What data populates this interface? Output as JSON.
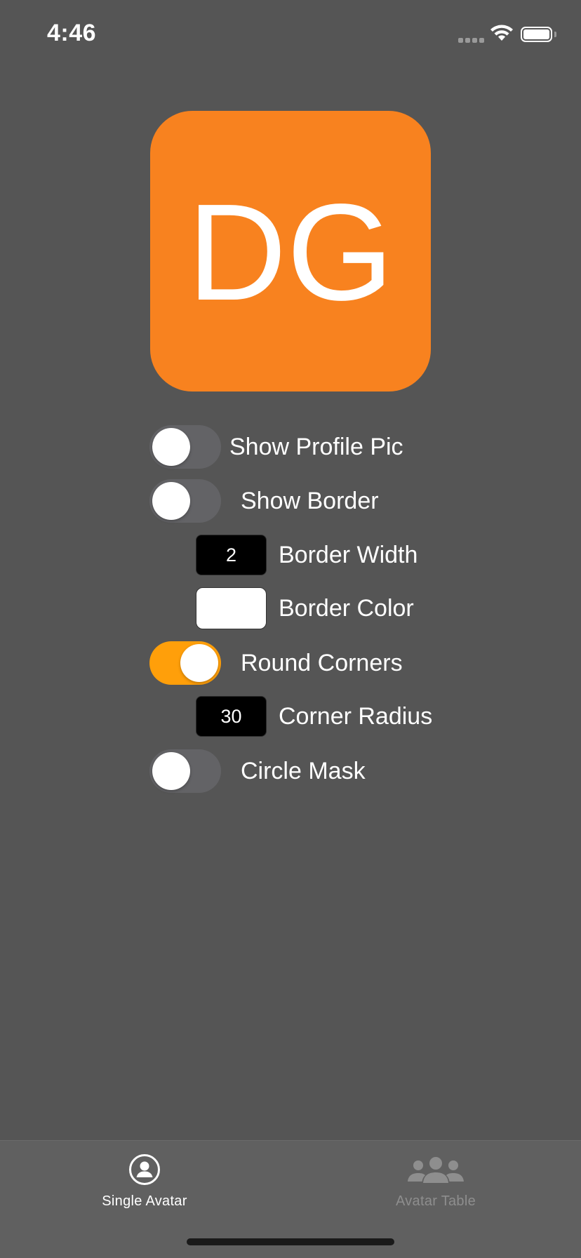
{
  "status_bar": {
    "time": "4:46",
    "signal_icon": "cellular-signal-icon",
    "wifi_icon": "wifi-icon",
    "battery_icon": "battery-icon"
  },
  "avatar": {
    "initials": "DG",
    "background_color": "#F8821F",
    "text_color": "#FFFFFF"
  },
  "controls": {
    "show_profile_pic": {
      "label": "Show Profile Pic",
      "on": false
    },
    "show_border": {
      "label": "Show Border",
      "on": false
    },
    "border_width": {
      "label": "Border Width",
      "value": "2"
    },
    "border_color": {
      "label": "Border Color",
      "value": "#FFFFFF"
    },
    "round_corners": {
      "label": "Round Corners",
      "on": true
    },
    "corner_radius": {
      "label": "Corner Radius",
      "value": "30"
    },
    "circle_mask": {
      "label": "Circle Mask",
      "on": false
    }
  },
  "colors": {
    "accent": "#FF9F0A",
    "background": "#555555",
    "tab_bar": "#606060",
    "tab_active": "#FFFFFF",
    "tab_inactive": "#8E8E8E"
  },
  "tab_bar": {
    "tabs": [
      {
        "label": "Single Avatar",
        "icon": "person-circle-icon",
        "selected": true
      },
      {
        "label": "Avatar Table",
        "icon": "person-group-icon",
        "selected": false
      }
    ]
  }
}
